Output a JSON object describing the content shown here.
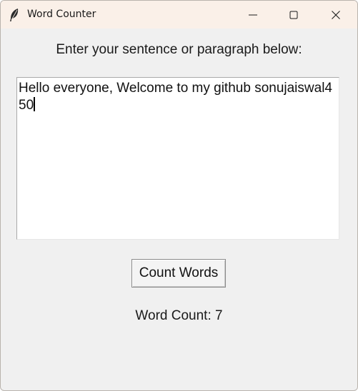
{
  "window": {
    "title": "Word Counter",
    "icon": "feather-icon",
    "controls": [
      "minimize-icon",
      "maximize-icon",
      "close-icon"
    ]
  },
  "main": {
    "prompt": "Enter your sentence or paragraph below:",
    "input_text": "Hello everyone, Welcome to my github sonujaiswal450",
    "button_label": "Count Words",
    "result_text": "Word Count: 7"
  },
  "colors": {
    "titlebar_bg": "#faf0e8",
    "window_bg": "#f0f0f0",
    "input_bg": "#ffffff"
  }
}
